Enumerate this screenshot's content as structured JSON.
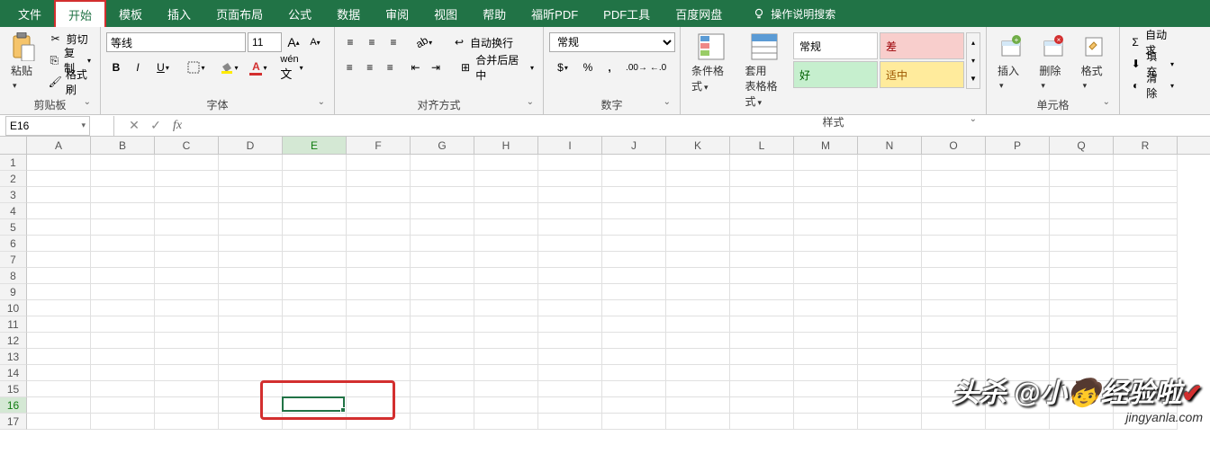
{
  "tabs": {
    "file": "文件",
    "start": "开始",
    "template": "模板",
    "insert": "插入",
    "layout": "页面布局",
    "formula": "公式",
    "data": "数据",
    "review": "审阅",
    "view": "视图",
    "help": "帮助",
    "foxit": "福昕PDF",
    "pdftool": "PDF工具",
    "baidu": "百度网盘",
    "tellme": "操作说明搜索"
  },
  "clipboard": {
    "paste": "粘贴",
    "cut": "剪切",
    "copy": "复制",
    "painter": "格式刷",
    "label": "剪贴板"
  },
  "font": {
    "name": "等线",
    "size": "11",
    "label": "字体"
  },
  "align": {
    "wrap": "自动换行",
    "merge": "合并后居中",
    "label": "对齐方式"
  },
  "number": {
    "format": "常规",
    "label": "数字"
  },
  "condfmt": "条件格式",
  "tablefmt": "套用\n表格格式",
  "styles": {
    "normal": "常规",
    "bad": "差",
    "good": "好",
    "neutral": "适中",
    "label": "样式"
  },
  "cells": {
    "insert": "插入",
    "delete": "删除",
    "format": "格式",
    "label": "单元格"
  },
  "editing": {
    "autosum": "自动求",
    "fill": "填充",
    "clear": "清除"
  },
  "namebox": "E16",
  "cols": [
    "A",
    "B",
    "C",
    "D",
    "E",
    "F",
    "G",
    "H",
    "I",
    "J",
    "K",
    "L",
    "M",
    "N",
    "O",
    "P",
    "Q",
    "R"
  ],
  "rows": [
    1,
    2,
    3,
    4,
    5,
    6,
    7,
    8,
    9,
    10,
    11,
    12,
    13,
    14,
    15,
    16,
    17
  ],
  "selected_cell": {
    "row": 16,
    "col": "E",
    "col_index": 4
  },
  "watermark": {
    "main_pre": "头杀 @小",
    "main_post": "经验啦",
    "sub": "jingyanla.com"
  }
}
